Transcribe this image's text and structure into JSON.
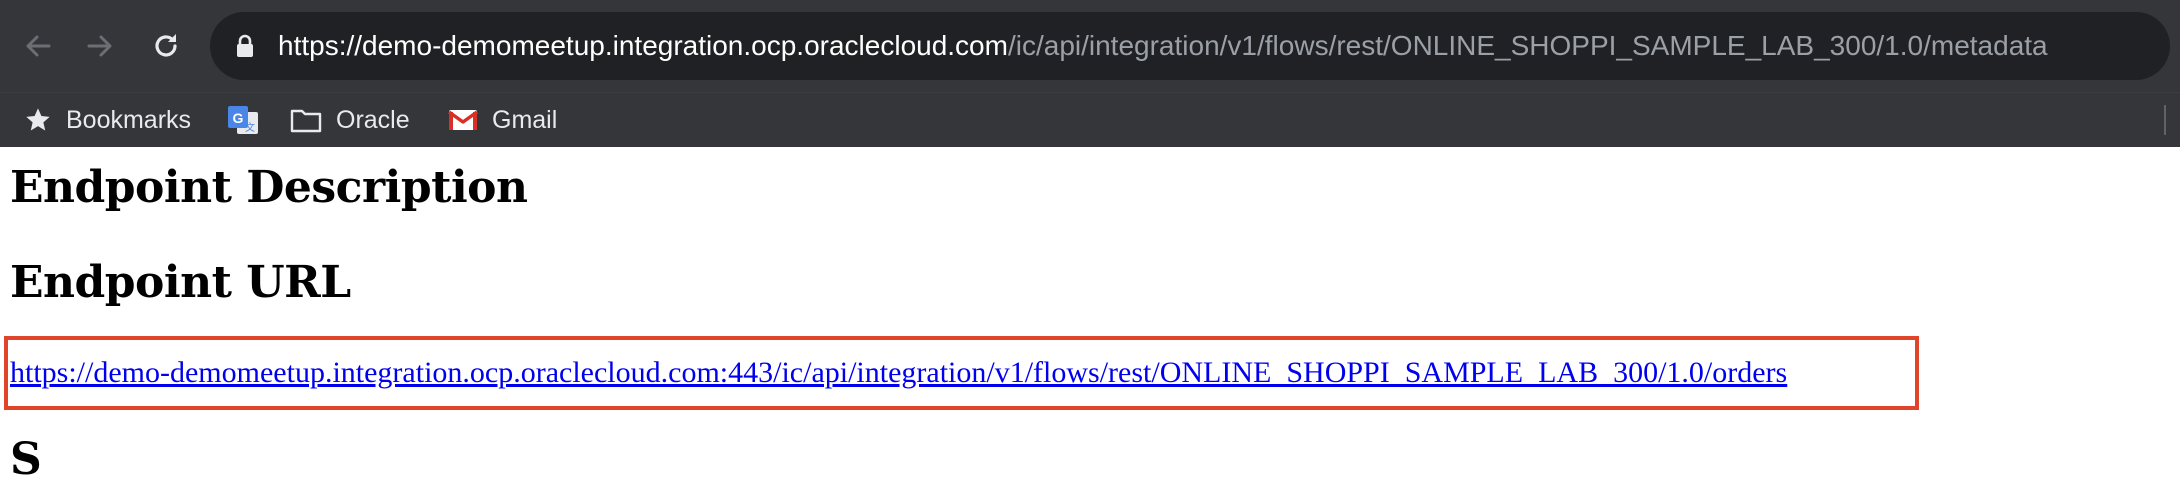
{
  "browser": {
    "address_bar": {
      "host": "https://demo-demomeetup.integration.ocp.oraclecloud.com",
      "path": "/ic/api/integration/v1/flows/rest/ONLINE_SHOPPI_SAMPLE_LAB_300/1.0/metadata",
      "secure_icon": "lock-icon"
    },
    "nav_icons": [
      "back-arrow-icon",
      "forward-arrow-icon",
      "reload-icon"
    ],
    "bookmarks": [
      {
        "label": "Bookmarks",
        "icon": "star-icon"
      },
      {
        "label": "",
        "icon": "google-translate-icon"
      },
      {
        "label": "Oracle",
        "icon": "folder-icon"
      },
      {
        "label": "Gmail",
        "icon": "gmail-icon"
      }
    ]
  },
  "page": {
    "heading_description": "Endpoint Description",
    "heading_url": "Endpoint URL",
    "endpoint_link": "https://demo-demomeetup.integration.ocp.oraclecloud.com:443/ic/api/integration/v1/flows/rest/ONLINE_SHOPPI_SAMPLE_LAB_300/1.0/orders",
    "next_heading_partial": "S",
    "highlight_color": "#e0442b",
    "link_color": "#0000ee"
  }
}
